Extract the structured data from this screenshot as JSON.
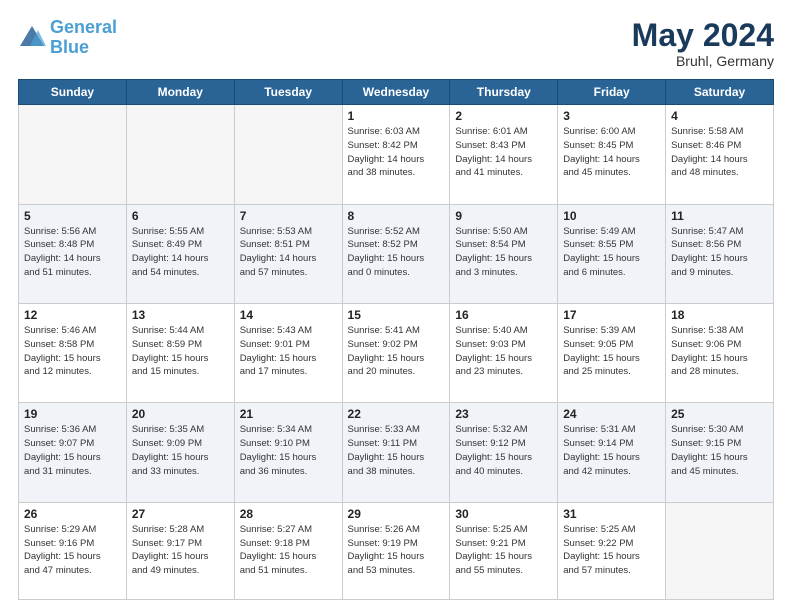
{
  "header": {
    "logo_line1": "General",
    "logo_line2": "Blue",
    "month_year": "May 2024",
    "location": "Bruhl, Germany"
  },
  "days_of_week": [
    "Sunday",
    "Monday",
    "Tuesday",
    "Wednesday",
    "Thursday",
    "Friday",
    "Saturday"
  ],
  "weeks": [
    {
      "alt": false,
      "days": [
        {
          "num": "",
          "empty": true,
          "info": ""
        },
        {
          "num": "",
          "empty": true,
          "info": ""
        },
        {
          "num": "",
          "empty": true,
          "info": ""
        },
        {
          "num": "1",
          "empty": false,
          "info": "Sunrise: 6:03 AM\nSunset: 8:42 PM\nDaylight: 14 hours\nand 38 minutes."
        },
        {
          "num": "2",
          "empty": false,
          "info": "Sunrise: 6:01 AM\nSunset: 8:43 PM\nDaylight: 14 hours\nand 41 minutes."
        },
        {
          "num": "3",
          "empty": false,
          "info": "Sunrise: 6:00 AM\nSunset: 8:45 PM\nDaylight: 14 hours\nand 45 minutes."
        },
        {
          "num": "4",
          "empty": false,
          "info": "Sunrise: 5:58 AM\nSunset: 8:46 PM\nDaylight: 14 hours\nand 48 minutes."
        }
      ]
    },
    {
      "alt": true,
      "days": [
        {
          "num": "5",
          "empty": false,
          "info": "Sunrise: 5:56 AM\nSunset: 8:48 PM\nDaylight: 14 hours\nand 51 minutes."
        },
        {
          "num": "6",
          "empty": false,
          "info": "Sunrise: 5:55 AM\nSunset: 8:49 PM\nDaylight: 14 hours\nand 54 minutes."
        },
        {
          "num": "7",
          "empty": false,
          "info": "Sunrise: 5:53 AM\nSunset: 8:51 PM\nDaylight: 14 hours\nand 57 minutes."
        },
        {
          "num": "8",
          "empty": false,
          "info": "Sunrise: 5:52 AM\nSunset: 8:52 PM\nDaylight: 15 hours\nand 0 minutes."
        },
        {
          "num": "9",
          "empty": false,
          "info": "Sunrise: 5:50 AM\nSunset: 8:54 PM\nDaylight: 15 hours\nand 3 minutes."
        },
        {
          "num": "10",
          "empty": false,
          "info": "Sunrise: 5:49 AM\nSunset: 8:55 PM\nDaylight: 15 hours\nand 6 minutes."
        },
        {
          "num": "11",
          "empty": false,
          "info": "Sunrise: 5:47 AM\nSunset: 8:56 PM\nDaylight: 15 hours\nand 9 minutes."
        }
      ]
    },
    {
      "alt": false,
      "days": [
        {
          "num": "12",
          "empty": false,
          "info": "Sunrise: 5:46 AM\nSunset: 8:58 PM\nDaylight: 15 hours\nand 12 minutes."
        },
        {
          "num": "13",
          "empty": false,
          "info": "Sunrise: 5:44 AM\nSunset: 8:59 PM\nDaylight: 15 hours\nand 15 minutes."
        },
        {
          "num": "14",
          "empty": false,
          "info": "Sunrise: 5:43 AM\nSunset: 9:01 PM\nDaylight: 15 hours\nand 17 minutes."
        },
        {
          "num": "15",
          "empty": false,
          "info": "Sunrise: 5:41 AM\nSunset: 9:02 PM\nDaylight: 15 hours\nand 20 minutes."
        },
        {
          "num": "16",
          "empty": false,
          "info": "Sunrise: 5:40 AM\nSunset: 9:03 PM\nDaylight: 15 hours\nand 23 minutes."
        },
        {
          "num": "17",
          "empty": false,
          "info": "Sunrise: 5:39 AM\nSunset: 9:05 PM\nDaylight: 15 hours\nand 25 minutes."
        },
        {
          "num": "18",
          "empty": false,
          "info": "Sunrise: 5:38 AM\nSunset: 9:06 PM\nDaylight: 15 hours\nand 28 minutes."
        }
      ]
    },
    {
      "alt": true,
      "days": [
        {
          "num": "19",
          "empty": false,
          "info": "Sunrise: 5:36 AM\nSunset: 9:07 PM\nDaylight: 15 hours\nand 31 minutes."
        },
        {
          "num": "20",
          "empty": false,
          "info": "Sunrise: 5:35 AM\nSunset: 9:09 PM\nDaylight: 15 hours\nand 33 minutes."
        },
        {
          "num": "21",
          "empty": false,
          "info": "Sunrise: 5:34 AM\nSunset: 9:10 PM\nDaylight: 15 hours\nand 36 minutes."
        },
        {
          "num": "22",
          "empty": false,
          "info": "Sunrise: 5:33 AM\nSunset: 9:11 PM\nDaylight: 15 hours\nand 38 minutes."
        },
        {
          "num": "23",
          "empty": false,
          "info": "Sunrise: 5:32 AM\nSunset: 9:12 PM\nDaylight: 15 hours\nand 40 minutes."
        },
        {
          "num": "24",
          "empty": false,
          "info": "Sunrise: 5:31 AM\nSunset: 9:14 PM\nDaylight: 15 hours\nand 42 minutes."
        },
        {
          "num": "25",
          "empty": false,
          "info": "Sunrise: 5:30 AM\nSunset: 9:15 PM\nDaylight: 15 hours\nand 45 minutes."
        }
      ]
    },
    {
      "alt": false,
      "days": [
        {
          "num": "26",
          "empty": false,
          "info": "Sunrise: 5:29 AM\nSunset: 9:16 PM\nDaylight: 15 hours\nand 47 minutes."
        },
        {
          "num": "27",
          "empty": false,
          "info": "Sunrise: 5:28 AM\nSunset: 9:17 PM\nDaylight: 15 hours\nand 49 minutes."
        },
        {
          "num": "28",
          "empty": false,
          "info": "Sunrise: 5:27 AM\nSunset: 9:18 PM\nDaylight: 15 hours\nand 51 minutes."
        },
        {
          "num": "29",
          "empty": false,
          "info": "Sunrise: 5:26 AM\nSunset: 9:19 PM\nDaylight: 15 hours\nand 53 minutes."
        },
        {
          "num": "30",
          "empty": false,
          "info": "Sunrise: 5:25 AM\nSunset: 9:21 PM\nDaylight: 15 hours\nand 55 minutes."
        },
        {
          "num": "31",
          "empty": false,
          "info": "Sunrise: 5:25 AM\nSunset: 9:22 PM\nDaylight: 15 hours\nand 57 minutes."
        },
        {
          "num": "",
          "empty": true,
          "info": ""
        }
      ]
    }
  ]
}
